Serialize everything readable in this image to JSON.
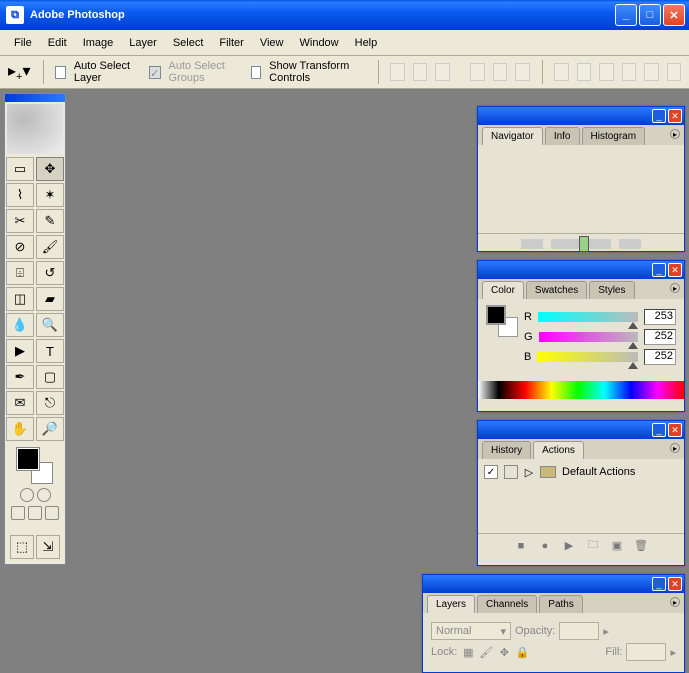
{
  "window": {
    "title": "Adobe Photoshop"
  },
  "menu": [
    "File",
    "Edit",
    "Image",
    "Layer",
    "Select",
    "Filter",
    "View",
    "Window",
    "Help"
  ],
  "options": {
    "auto_select_layer": "Auto Select Layer",
    "auto_select_groups": "Auto Select Groups",
    "show_transform": "Show Transform Controls"
  },
  "panels": {
    "navigator": {
      "tabs": [
        "Navigator",
        "Info",
        "Histogram"
      ],
      "active": 0
    },
    "color": {
      "tabs": [
        "Color",
        "Swatches",
        "Styles"
      ],
      "active": 0,
      "channels": [
        {
          "label": "R",
          "value": "253"
        },
        {
          "label": "G",
          "value": "252"
        },
        {
          "label": "B",
          "value": "252"
        }
      ]
    },
    "actions": {
      "tabs": [
        "History",
        "Actions"
      ],
      "active": 1,
      "default_set": "Default Actions"
    },
    "layers": {
      "tabs": [
        "Layers",
        "Channels",
        "Paths"
      ],
      "active": 0,
      "blend_mode": "Normal",
      "opacity_label": "Opacity:",
      "lock_label": "Lock:",
      "fill_label": "Fill:"
    }
  }
}
